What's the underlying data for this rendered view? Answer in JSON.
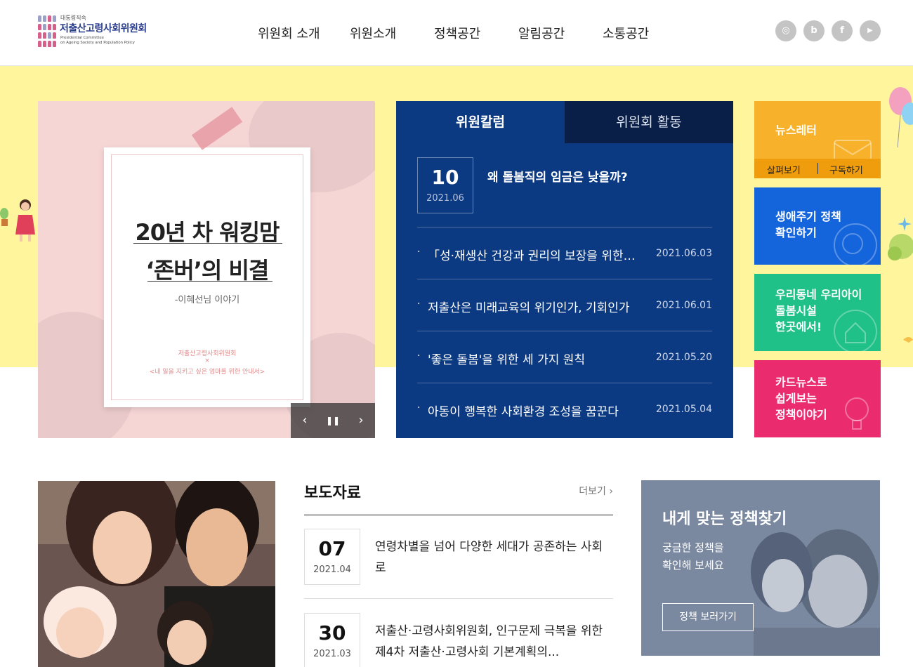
{
  "header": {
    "logo": {
      "sup": "대통령직속",
      "name": "저출산고령사회위원회",
      "en_line1": "Presidential Committee",
      "en_line2": "on Ageing Society and Population Policy"
    },
    "nav": [
      "위원회 소개",
      "위원소개",
      "정책공간",
      "알림공간",
      "소통공간"
    ],
    "social": [
      {
        "icon": "instagram-icon",
        "glyph": "◎"
      },
      {
        "icon": "blog-icon",
        "glyph": "b"
      },
      {
        "icon": "facebook-icon",
        "glyph": "f"
      },
      {
        "icon": "youtube-icon",
        "glyph": "▶"
      }
    ]
  },
  "slide": {
    "title_line1": "20년 차 워킹맘",
    "title_line2": "‘존버’의 비결",
    "subtitle": "-이혜선님 이야기",
    "org": "저출산고령사회위원회",
    "org_x": "×",
    "caption": "<내 일을 지키고 싶은 엄마를 위한 안내서>",
    "controls": {
      "prev": "‹",
      "pause": "❚❚",
      "next": "›"
    }
  },
  "column": {
    "tabs": [
      "위원칼럼",
      "위원회 활동"
    ],
    "featured": {
      "day": "10",
      "month": "2021.06",
      "title": "왜 돌봄직의 임금은 낮을까?"
    },
    "items": [
      {
        "bullet": "·",
        "title": "「성·재생산 건강과 권리의 보장을 위한 ...",
        "date": "2021.06.03"
      },
      {
        "bullet": "·",
        "title": "저출산은 미래교육의 위기인가, 기회인가",
        "date": "2021.06.01"
      },
      {
        "bullet": "·",
        "title": "'좋은 돌봄'을 위한 세 가지 원칙",
        "date": "2021.05.20"
      },
      {
        "bullet": "·",
        "title": "아동이 행복한 사회환경 조성을 꿈꾼다",
        "date": "2021.05.04"
      }
    ]
  },
  "quick": {
    "newsletter": {
      "label": "뉴스레터",
      "view": "살펴보기",
      "subscribe": "구독하기"
    },
    "lifecycle": {
      "label": "생애주기 정책\n확인하기"
    },
    "care": {
      "label": "우리동네 우리아이\n돌봄시설\n한곳에서!"
    },
    "cardnews": {
      "label": "카드뉴스로\n쉽게보는\n정책이야기"
    }
  },
  "press": {
    "title": "보도자료",
    "more": "더보기 ›",
    "items": [
      {
        "day": "07",
        "month": "2021.04",
        "title": "연령차별을 넘어 다양한 세대가 공존하는 사회로"
      },
      {
        "day": "30",
        "month": "2021.03",
        "title": "저출산·고령사회위원회, 인구문제 극복을 위한 제4차 저출산·고령사회 기본계획의..."
      }
    ]
  },
  "policy": {
    "title": "내게 맞는 정책찾기",
    "desc": "궁금한 정책을\n확인해 보세요",
    "button": "정책 보러가기"
  },
  "colors": {
    "band": "#fff59d",
    "navy": "#0c3a82",
    "newsletter": "#f8b12a",
    "lifecycle": "#1464db",
    "care": "#20c089",
    "cardnews": "#ea2b6e",
    "policy": "#7b89a0"
  }
}
